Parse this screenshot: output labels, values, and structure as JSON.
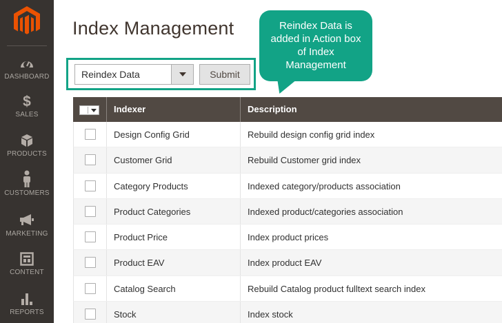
{
  "sidebar": {
    "logo": "magento-logo",
    "items": [
      {
        "label": "DASHBOARD",
        "icon": "dashboard-gauge-icon"
      },
      {
        "label": "SALES",
        "icon": "dollar-icon"
      },
      {
        "label": "PRODUCTS",
        "icon": "cube-icon"
      },
      {
        "label": "CUSTOMERS",
        "icon": "person-icon"
      },
      {
        "label": "MARKETING",
        "icon": "megaphone-icon"
      },
      {
        "label": "CONTENT",
        "icon": "layout-icon"
      },
      {
        "label": "REPORTS",
        "icon": "bar-chart-icon"
      }
    ]
  },
  "page": {
    "title": "Index Management"
  },
  "actions": {
    "selected_action": "Reindex Data",
    "submit_label": "Submit"
  },
  "callout": {
    "text": "Reindex Data is added in Action box of Index Management"
  },
  "grid": {
    "columns": [
      "Indexer",
      "Description"
    ],
    "rows": [
      {
        "indexer": "Design Config Grid",
        "description": "Rebuild design config grid index"
      },
      {
        "indexer": "Customer Grid",
        "description": "Rebuild Customer grid index"
      },
      {
        "indexer": "Category Products",
        "description": "Indexed category/products association"
      },
      {
        "indexer": "Product Categories",
        "description": "Indexed product/categories association"
      },
      {
        "indexer": "Product Price",
        "description": "Index product prices"
      },
      {
        "indexer": "Product EAV",
        "description": "Index product EAV"
      },
      {
        "indexer": "Catalog Search",
        "description": "Rebuild Catalog product fulltext search index"
      },
      {
        "indexer": "Stock",
        "description": "Index stock"
      }
    ]
  },
  "colors": {
    "sidebar_bg": "#373330",
    "accent_orange": "#eb5202",
    "callout_green": "#12a386",
    "grid_header_bg": "#514943"
  }
}
